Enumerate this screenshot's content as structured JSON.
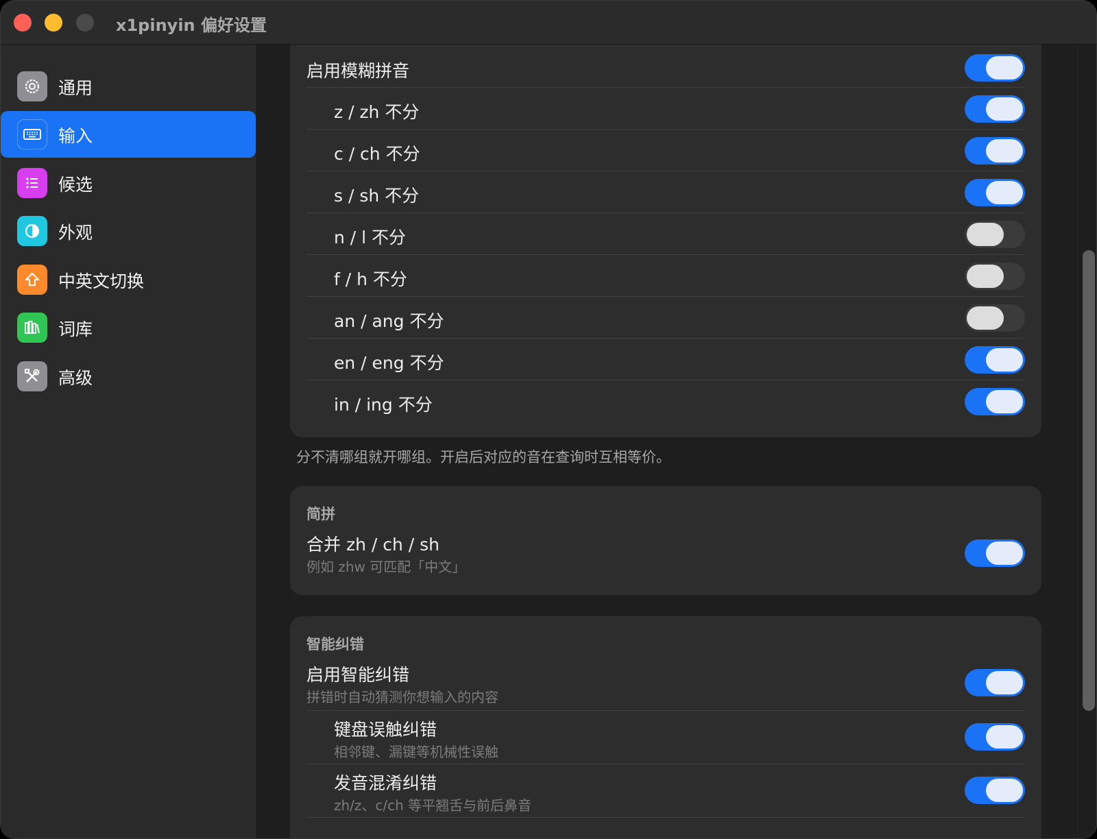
{
  "window": {
    "title": "x1pinyin 偏好设置"
  },
  "sidebar": {
    "items": [
      {
        "label": "通用",
        "icon": "gear-icon",
        "color": "#8e8e93",
        "active": false
      },
      {
        "label": "输入",
        "icon": "keyboard-icon",
        "color": "#1a73f4",
        "active": true
      },
      {
        "label": "候选",
        "icon": "list-icon",
        "color": "#d63ef0",
        "active": false
      },
      {
        "label": "外观",
        "icon": "contrast-icon",
        "color": "#1fc8e0",
        "active": false
      },
      {
        "label": "中英文切换",
        "icon": "shift-arrow-icon",
        "color": "#ff8a2b",
        "active": false
      },
      {
        "label": "词库",
        "icon": "books-icon",
        "color": "#2fc653",
        "active": false
      },
      {
        "label": "高级",
        "icon": "tools-icon",
        "color": "#8e8e93",
        "active": false
      }
    ]
  },
  "fuzzy": {
    "enable_label": "启用模糊拼音",
    "enable_on": true,
    "rows": [
      {
        "label": "z / zh 不分",
        "on": true
      },
      {
        "label": "c / ch 不分",
        "on": true
      },
      {
        "label": "s / sh 不分",
        "on": true
      },
      {
        "label": "n / l 不分",
        "on": false
      },
      {
        "label": "f / h 不分",
        "on": false
      },
      {
        "label": "an / ang 不分",
        "on": false
      },
      {
        "label": "en / eng 不分",
        "on": true
      },
      {
        "label": "in / ing 不分",
        "on": true
      }
    ],
    "note": "分不清哪组就开哪组。开启后对应的音在查询时互相等价。"
  },
  "jianpin": {
    "header": "简拼",
    "label": "合并 zh / ch / sh",
    "sub": "例如 zhw 可匹配「中文」",
    "on": true
  },
  "correction": {
    "header": "智能纠错",
    "rows": [
      {
        "label": "启用智能纠错",
        "sub": "拼错时自动猜测你想输入的内容",
        "on": true,
        "indent": false
      },
      {
        "label": "键盘误触纠错",
        "sub": "相邻键、漏键等机械性误触",
        "on": true,
        "indent": true
      },
      {
        "label": "发音混淆纠错",
        "sub": "zh/z、c/ch 等平翘舌与前后鼻音",
        "on": true,
        "indent": true
      }
    ]
  }
}
